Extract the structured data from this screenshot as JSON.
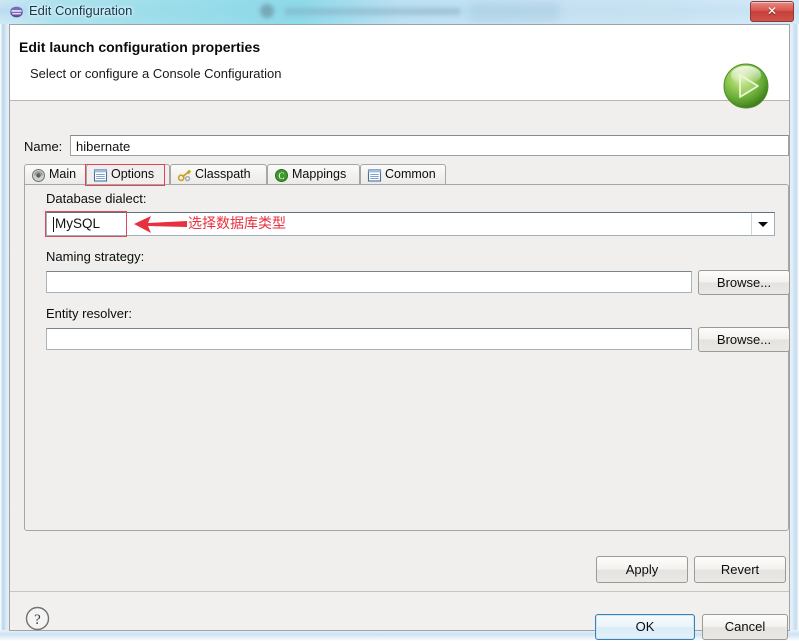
{
  "window": {
    "title": "Edit Configuration",
    "title_icon": "eclipse-launch-icon",
    "close_label": "✕"
  },
  "header": {
    "title": "Edit launch configuration properties",
    "subtitle": "Select or configure a Console Configuration",
    "badge_icon": "green-run-play-icon"
  },
  "name_row": {
    "label": "Name:",
    "value": "hibernate",
    "placeholder": ""
  },
  "tabs": [
    {
      "label": "Main",
      "icon": "main-tab-icon",
      "selected": false
    },
    {
      "label": "Options",
      "icon": "options-tab-icon",
      "selected": true
    },
    {
      "label": "Classpath",
      "icon": "classpath-tab-icon",
      "selected": false
    },
    {
      "label": "Mappings",
      "icon": "mappings-tab-icon",
      "selected": false
    },
    {
      "label": "Common",
      "icon": "common-tab-icon",
      "selected": false
    }
  ],
  "options_panel": {
    "dialect": {
      "label": "Database dialect:",
      "value": "MySQL",
      "dropdown_icon": "chevron-down-icon"
    },
    "naming_strategy": {
      "label": "Naming strategy:",
      "value": "",
      "browse_label": "Browse..."
    },
    "entity_resolver": {
      "label": "Entity resolver:",
      "value": "",
      "browse_label": "Browse..."
    }
  },
  "annotation": {
    "text": "选择数据库类型",
    "arrow_icon": "left-arrow-annotation-icon",
    "color": "#e8313f",
    "box_color": "#e04a5a"
  },
  "buttons": {
    "apply": "Apply",
    "revert": "Revert",
    "ok": "OK",
    "cancel": "Cancel",
    "help_icon": "help-question-icon"
  },
  "colors": {
    "dialog_bg": "#f0efed",
    "header_bg": "#ffffff",
    "accent_blue": "#3c7fb1",
    "close_red": "#c63f38",
    "annotation_red": "#e8313f",
    "run_green": "#6bb33d"
  }
}
